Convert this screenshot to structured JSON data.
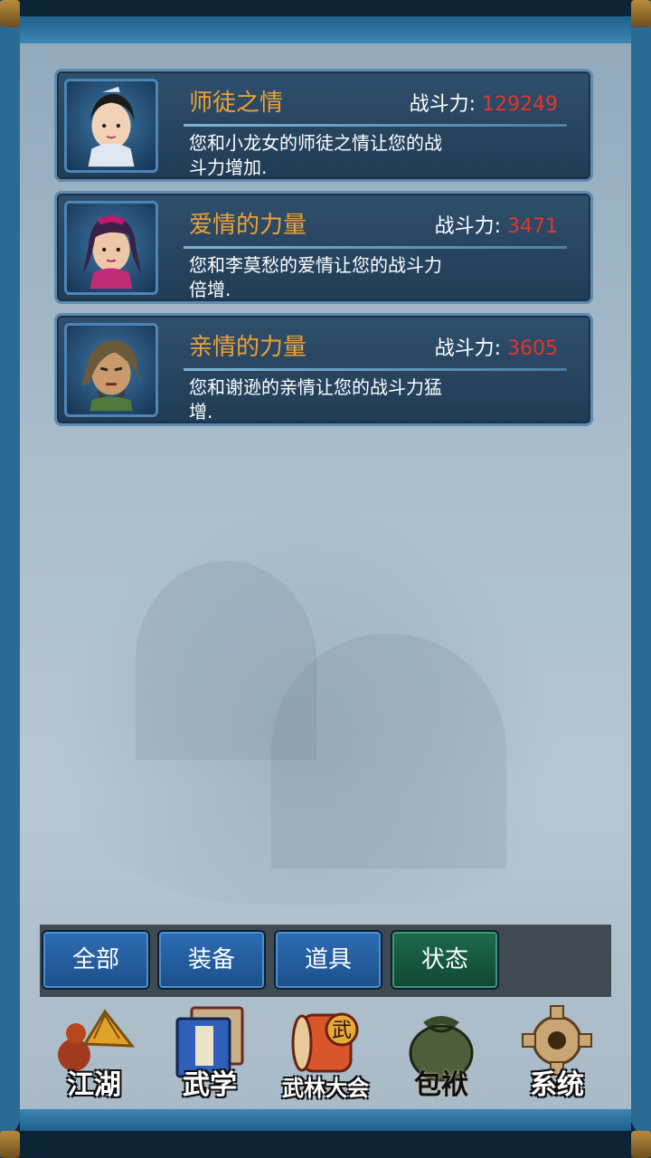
{
  "bonds": [
    {
      "title": "师徒之情",
      "power_label": "战斗力:",
      "power_value": "129249",
      "desc": "您和小龙女的师徒之情让您的战斗力增加."
    },
    {
      "title": "爱情的力量",
      "power_label": "战斗力:",
      "power_value": "3471",
      "desc": "您和李莫愁的爱情让您的战斗力倍增."
    },
    {
      "title": "亲情的力量",
      "power_label": "战斗力:",
      "power_value": "3605",
      "desc": "您和谢逊的亲情让您的战斗力猛增."
    }
  ],
  "tabs": [
    {
      "label": "全部",
      "active": false
    },
    {
      "label": "装备",
      "active": false
    },
    {
      "label": "道具",
      "active": false
    },
    {
      "label": "状态",
      "active": true
    }
  ],
  "nav": [
    {
      "label": "江湖",
      "icon": "gourd-hat-icon"
    },
    {
      "label": "武学",
      "icon": "book-icon"
    },
    {
      "label": "武林大会",
      "icon": "drum-icon",
      "badge": "武"
    },
    {
      "label": "包袱",
      "icon": "bag-icon",
      "active": true
    },
    {
      "label": "系统",
      "icon": "gear-icon"
    }
  ],
  "colors": {
    "title": "#f0a034",
    "power_value": "#e8332a",
    "tab_active": "#1d6a4d",
    "tab": "#1c4f8a"
  }
}
